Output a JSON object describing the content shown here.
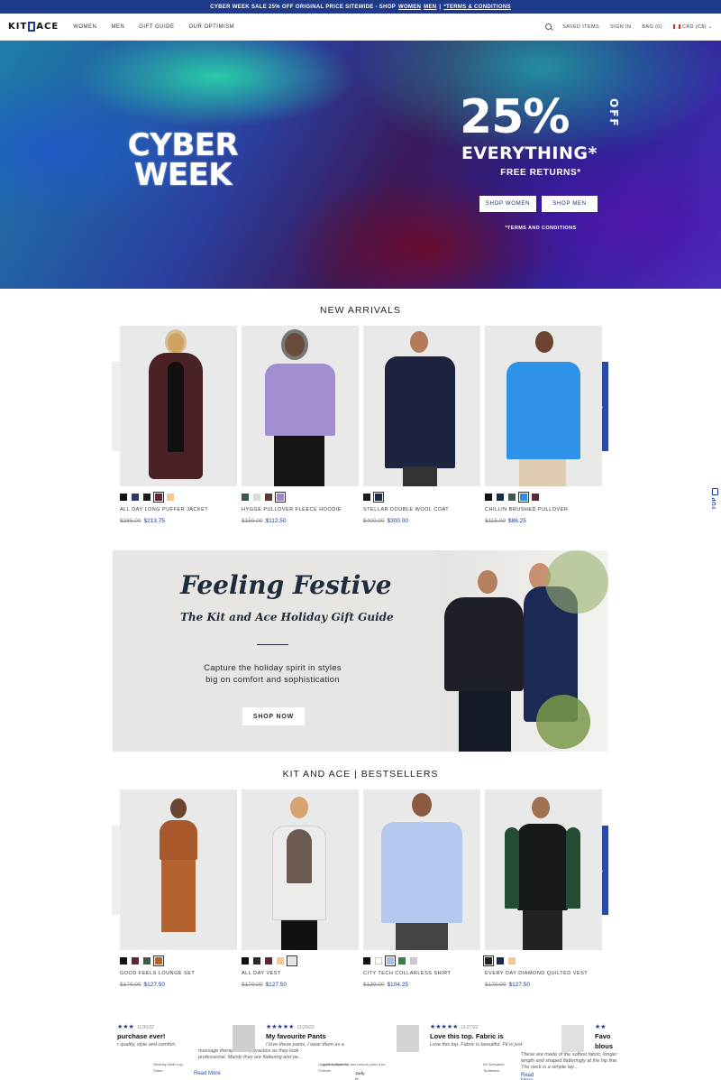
{
  "promo": {
    "text": "CYBER WEEK SALE 25% OFF ORIGINAL PRICE SITEWIDE - SHOP",
    "link_women": "WOMEN",
    "link_men": "MEN",
    "sep": "|",
    "link_terms": "*TERMS & CONDITIONS"
  },
  "header": {
    "logo_left": "KIT",
    "logo_right": "ACE",
    "nav": [
      "WOMEN",
      "MEN",
      "GIFT GUIDE",
      "OUR OPTIMISM"
    ],
    "saved": "SAVED ITEMS",
    "signin": "SIGN IN",
    "bag": "BAG (0)",
    "currency": "CAD (C$)"
  },
  "hero": {
    "line1": "CYBER",
    "line2": "WEEK",
    "big": "25%",
    "off": "OFF",
    "everything": "EVERYTHING*",
    "free": "FREE RETURNS*",
    "btn_women": "SHOP WOMEN",
    "btn_men": "SHOP MEN",
    "terms": "*TERMS AND CONDITIONS"
  },
  "new_arrivals": {
    "title": "NEW ARRIVALS",
    "items": [
      {
        "name": "ALL DAY LONG PUFFER JACKET",
        "old": "$285.00",
        "price": "$213.75",
        "swatches": [
          "#111111",
          "#2b3a6b",
          "#1a1a1a",
          "#5a2a3a",
          "#f2c79a"
        ],
        "selected": 3
      },
      {
        "name": "HYGGE PULLOVER FLEECE HOODIE",
        "old": "$150.00",
        "price": "$112.50",
        "swatches": [
          "#3f5a4a",
          "#dcdcd6",
          "#5a3a32",
          "#9d86c9"
        ],
        "selected": 3
      },
      {
        "name": "STELLAR DOUBLE WOOL COAT",
        "old": "$400.00",
        "price": "$300.00",
        "swatches": [
          "#1a1a1a",
          "#1e2a4a"
        ],
        "selected": 1
      },
      {
        "name": "CHILLIN BRUSHED PULLOVER",
        "old": "$115.00",
        "price": "$86.25",
        "swatches": [
          "#111111",
          "#1e2a4a",
          "#3f5a4a",
          "#2e8fe0",
          "#5a2a3a"
        ],
        "selected": 3
      }
    ]
  },
  "festive": {
    "title": "Feeling Festive",
    "subtitle": "The Kit and Ace Holiday Gift Guide",
    "caption": "Capture the holiday spirit in styles big on comfort and sophistication",
    "button": "SHOP NOW"
  },
  "bestsellers": {
    "title": "KIT AND ACE | BESTSELLERS",
    "items": [
      {
        "name": "GOOD FEELS LOUNGE SET",
        "old": "$170.00",
        "price": "$127.50",
        "swatches": [
          "#111111",
          "#5a2a3a",
          "#3f5a4a",
          "#b5632e"
        ],
        "selected": 3
      },
      {
        "name": "ALL DAY VEST",
        "old": "$170.00",
        "price": "$127.50",
        "swatches": [
          "#111111",
          "#2a2a2a",
          "#5a2a3a",
          "#f2c79a",
          "#e4e4de"
        ],
        "selected": 4
      },
      {
        "name": "CITY TECH COLLARLESS SHIRT",
        "old": "$139.00",
        "price": "$104.25",
        "swatches": [
          "#111111",
          "#ffffff",
          "#a8c0e8",
          "#3f7a4a",
          "#c8c8cc"
        ],
        "selected": 2
      },
      {
        "name": "EVERY DAY DIAMOND QUILTED VEST",
        "old": "$170.00",
        "price": "$127.50",
        "swatches": [
          "#222222",
          "#1e2a4a",
          "#f2c79a"
        ],
        "selected": 0
      }
    ]
  },
  "reviews": [
    {
      "stars": "★★★",
      "date": "11/30/22",
      "title": "purchase ever!",
      "body": "r quality, style and comfort.",
      "product": "Serenity Wide Leg Pants",
      "more": "Read More",
      "extra": "massage therapist in my practice as they look professional. Mainly they are flattering and pe..."
    },
    {
      "stars": "★★★★★",
      "date": "11/29/22",
      "title": "My favourite Pants",
      "body": "I love these pants, I wear them as a",
      "product": "Upgraded Serenity Pullover",
      "more": "",
      "extra": "right. bought it in two colours (also it so"
    },
    {
      "stars": "★★★★★",
      "date": "11/27/22",
      "title": "Love this top. Fabric is",
      "body": "Love this top. Fabric is beautiful. Fit is just",
      "product": "Kit Sensation Turtleneck",
      "more": "Read More",
      "extra": "These are made of the softest fabric, longer length and shaped flatteringly at the hip line. The neck is a simple lay..."
    },
    {
      "stars": "★★",
      "date": "",
      "title": "Favo",
      "body": "blous",
      "product": "",
      "more": "",
      "extra": ""
    }
  ],
  "reviewer": "Judy G.",
  "back_to_top": "TOP",
  "colors": {
    "brand": "#1f3a8a",
    "accent": "#2b4aa8"
  }
}
